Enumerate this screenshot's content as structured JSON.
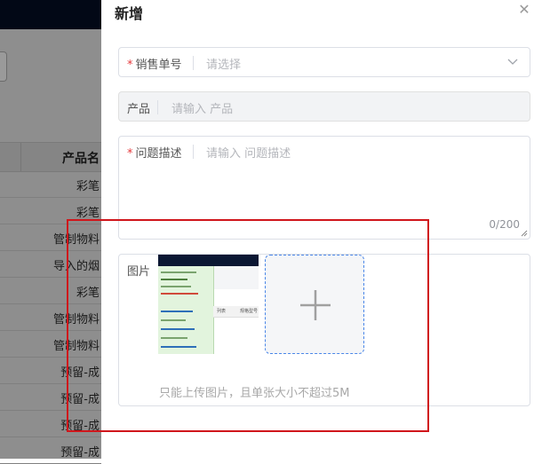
{
  "background": {
    "table_header": "产品名",
    "rows": [
      "彩笔",
      "彩笔",
      "管制物料",
      "导入的烟",
      "彩笔",
      "管制物料",
      "管制物料",
      "预留-成",
      "预留-成",
      "预留-成",
      "预留-成"
    ]
  },
  "drawer": {
    "title": "新增",
    "close_icon": "close-icon",
    "fields": {
      "sales_order": {
        "label": "销售单号",
        "required": true,
        "placeholder": "请选择",
        "icon": "chevron-down-icon"
      },
      "product": {
        "label": "产品",
        "required": false,
        "placeholder": "请输入 产品",
        "disabled": true
      },
      "problem": {
        "label": "问题描述",
        "required": true,
        "placeholder": "请输入 问题描述",
        "counter": "0/200"
      },
      "image": {
        "label": "图片",
        "hint": "只能上传图片，且单张大小不超过5M",
        "add_icon": "plus-icon"
      }
    }
  },
  "thumbnail_text": {
    "header_left": "列表",
    "header_right": "规格型号",
    "tiny_lines": [
      "修改模式编",
      "日常 · 智能",
      "批量导入",
      "新增导入文件",
      "备注 1 1503",
      "入库时间",
      "规格 NO.0045",
      "申请 NO.0015"
    ]
  },
  "colors": {
    "required": "#e5383b",
    "highlight": "#d0161b",
    "upload_border": "#4a86e8"
  }
}
